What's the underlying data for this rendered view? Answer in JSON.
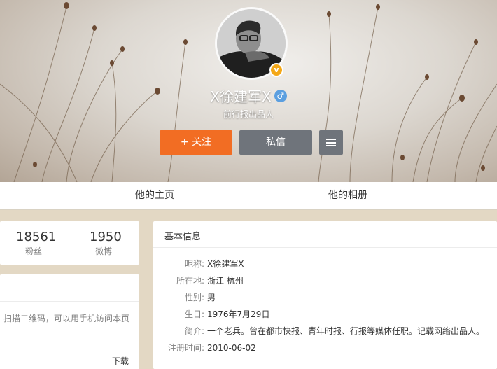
{
  "profile": {
    "name": "X徐建军X",
    "gender_symbol": "♂",
    "verified_symbol": "v",
    "description": "前行报出品人",
    "follow_label": "+ 关注",
    "message_label": "私信"
  },
  "tabs": [
    {
      "label": "他的主页"
    },
    {
      "label": "他的相册"
    }
  ],
  "stats": [
    {
      "value": "18561",
      "label": "粉丝"
    },
    {
      "value": "1950",
      "label": "微博"
    }
  ],
  "qr": {
    "text": "扫描二维码，可以用手机访问本页",
    "download_label": "下载"
  },
  "info": {
    "title": "基本信息",
    "rows": [
      {
        "key": "昵称:",
        "value": "X徐建军X"
      },
      {
        "key": "所在地:",
        "value": "浙江 杭州"
      },
      {
        "key": "性别:",
        "value": "男"
      },
      {
        "key": "生日:",
        "value": "1976年7月29日"
      },
      {
        "key": "简介:",
        "value": "一个老兵。曾在都市快报、青年时报、行报等媒体任职。记载网络出品人。"
      },
      {
        "key": "注册时间:",
        "value": "2010-06-02"
      }
    ]
  },
  "colors": {
    "follow": "#f26d23",
    "secondary_button": "#6f747b",
    "page_background": "#e3d8c4",
    "gender_badge": "#5b9fe0",
    "verified_badge": "#f4a818"
  },
  "icons": [
    "plus-icon",
    "menu-icon",
    "male-icon",
    "verified-icon"
  ]
}
